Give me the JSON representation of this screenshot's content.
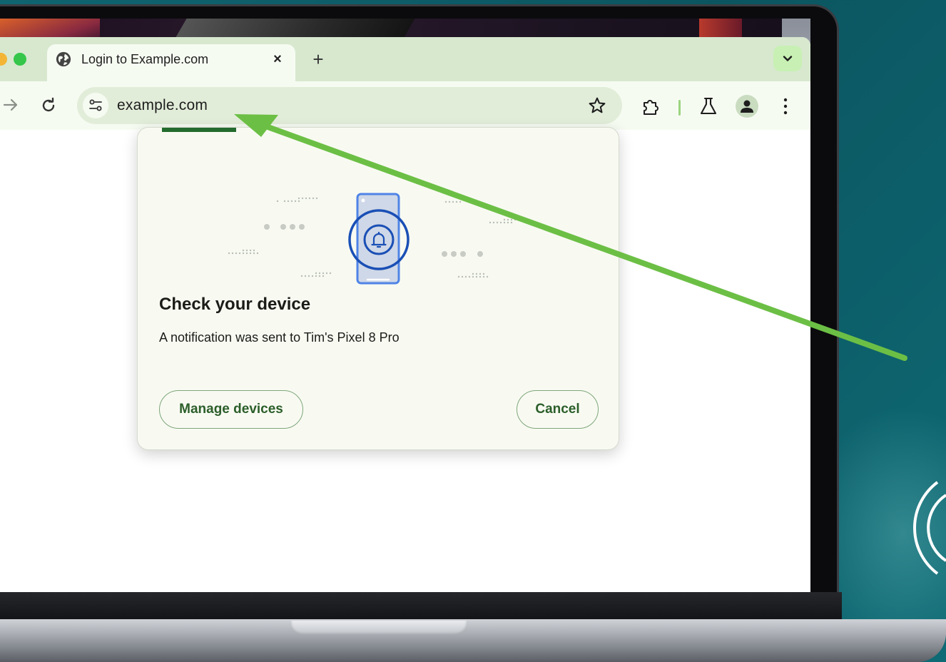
{
  "tab": {
    "title": "Login to Example.com",
    "close_label": "×",
    "new_tab_label": "+"
  },
  "omnibox": {
    "url": "example.com"
  },
  "dialog": {
    "title": "Check your device",
    "message": "A notification was sent to Tim's Pixel 8 Pro",
    "manage_button": "Manage devices",
    "cancel_button": "Cancel"
  },
  "icons": {
    "tab_favicon": "globe-icon",
    "forward": "arrow-forward-icon",
    "reload": "reload-icon",
    "site_info": "tune-icon",
    "bookmark": "star-icon",
    "extensions": "puzzle-icon",
    "labs": "flask-icon",
    "profile": "person-icon",
    "menu": "more-vert-icon",
    "tab_search": "chevron-down-icon",
    "illustration": "phone-bell-icon"
  },
  "colors": {
    "accent_green": "#236b2e",
    "arrow_green": "#6cbf45",
    "tabstrip": "#d7e8cf",
    "background": "#0d5a64"
  }
}
